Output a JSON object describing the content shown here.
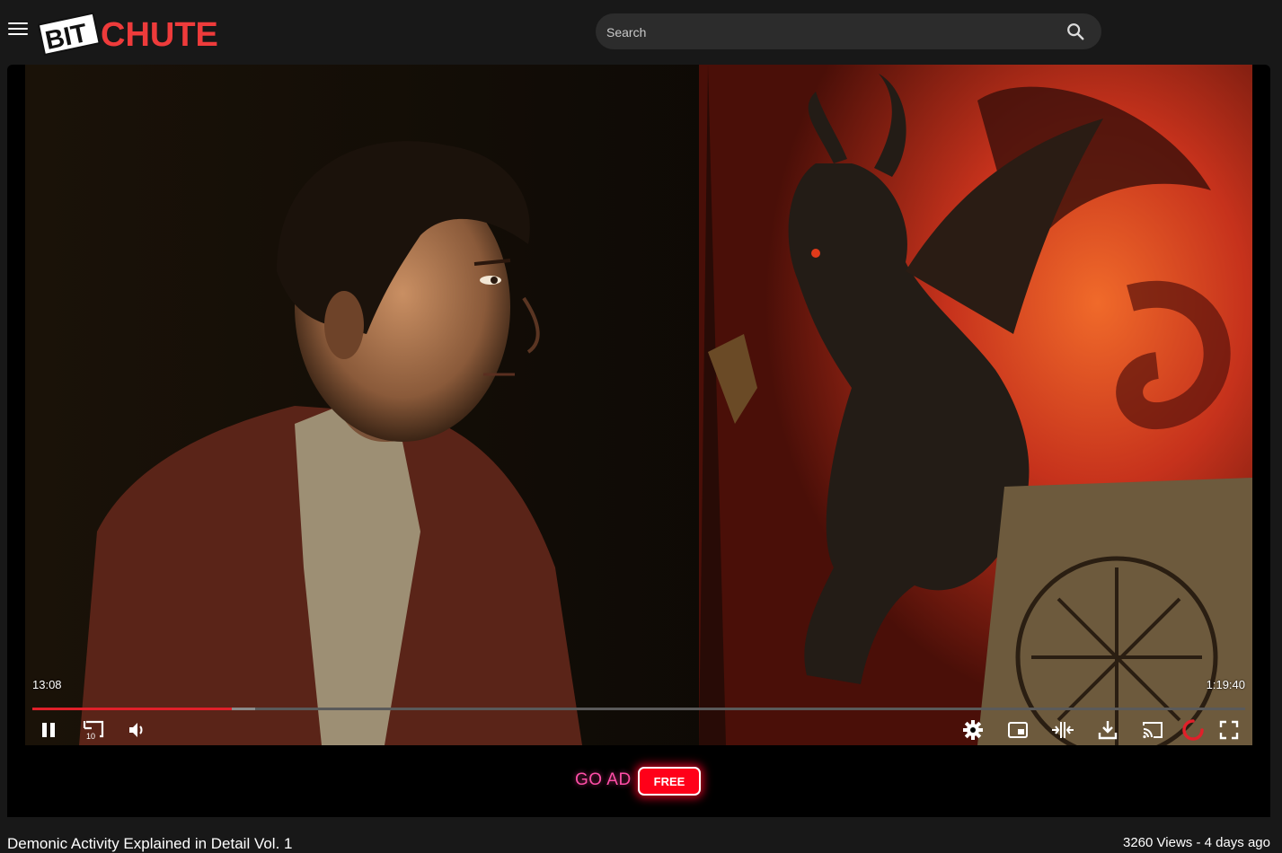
{
  "header": {
    "menu_icon": "hamburger-menu-icon",
    "logo": {
      "part1": "BIT",
      "part2": "CHUTE",
      "accent": "#ee3b3b"
    },
    "search": {
      "placeholder": "Search",
      "value": "",
      "icon": "search-icon"
    }
  },
  "player": {
    "current_time": "13:08",
    "duration": "1:19:40",
    "progress_fraction": 0.1645,
    "buffered_fraction": 0.1835,
    "controls_left": [
      "pause-icon",
      "rewind-10-icon",
      "volume-icon"
    ],
    "rewind_label": "10",
    "controls_right": [
      "settings-gear-icon",
      "picture-in-picture-icon",
      "theater-mode-icon",
      "download-icon",
      "cast-icon",
      "loading-spinner-icon",
      "fullscreen-icon"
    ],
    "accent": "#e0202a"
  },
  "ad": {
    "text": "GO AD",
    "button_label": "FREE"
  },
  "video": {
    "title": "Demonic Activity Explained in Detail Vol. 1",
    "meta": "3260 Views - 4 days ago"
  }
}
